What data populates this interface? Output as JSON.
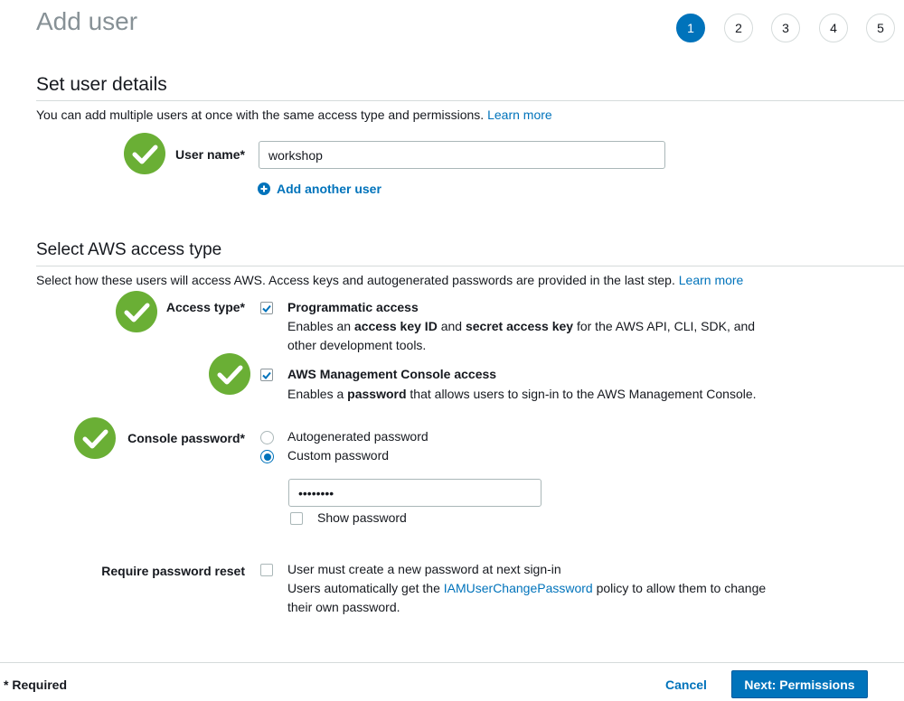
{
  "page": {
    "title": "Add user"
  },
  "steps": [
    "1",
    "2",
    "3",
    "4",
    "5"
  ],
  "active_step": "1",
  "details": {
    "heading": "Set user details",
    "description": "You can add multiple users at once with the same access type and permissions.",
    "learn_more": "Learn more",
    "user_name_label": "User name*",
    "user_name_value": "workshop",
    "add_another_user": "Add another user"
  },
  "access": {
    "heading": "Select AWS access type",
    "description": "Select how these users will access AWS. Access keys and autogenerated passwords are provided in the last step.",
    "learn_more": "Learn more",
    "access_type_label": "Access type*",
    "programmatic": {
      "title": "Programmatic access",
      "checked": true,
      "desc_1": "Enables an ",
      "desc_bold_1": "access key ID",
      "desc_2": " and ",
      "desc_bold_2": "secret access key",
      "desc_3": " for the AWS API, CLI, SDK, and",
      "desc_line2": "other development tools."
    },
    "console": {
      "title": "AWS Management Console access",
      "checked": true,
      "desc_1": "Enables a ",
      "desc_bold": "password",
      "desc_2": " that allows users to sign-in to the AWS Management Console."
    },
    "console_password_label": "Console password*",
    "autogenerated_password": "Autogenerated password",
    "custom_password": "Custom password",
    "selected_password_option": "Custom password",
    "password_value": "••••••••",
    "show_password": "Show password",
    "require_reset_label": "Require password reset",
    "require_reset_text": "User must create a new password at next sign-in",
    "reset_desc_1": "Users automatically get the ",
    "reset_policy_link": "IAMUserChangePassword",
    "reset_desc_2": " policy to allow them to change",
    "reset_desc_line2": "their own password."
  },
  "footer": {
    "required_note": "* Required",
    "cancel": "Cancel",
    "next": "Next: Permissions"
  },
  "colors": {
    "accent": "#0073bb",
    "success": "#6aaf35",
    "muted_title": "#879196"
  }
}
